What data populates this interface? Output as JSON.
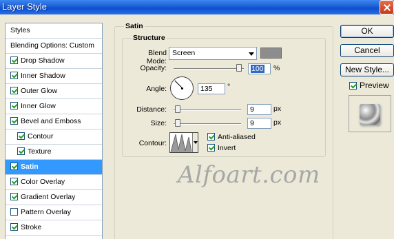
{
  "window": {
    "title": "Layer Style"
  },
  "styles_list": {
    "header": "Styles",
    "blending_options": "Blending Options: Custom",
    "items": [
      {
        "label": "Drop Shadow",
        "checked": true
      },
      {
        "label": "Inner Shadow",
        "checked": true
      },
      {
        "label": "Outer Glow",
        "checked": true
      },
      {
        "label": "Inner Glow",
        "checked": true
      },
      {
        "label": "Bevel and Emboss",
        "checked": true
      },
      {
        "label": "Contour",
        "checked": true
      },
      {
        "label": "Texture",
        "checked": true
      },
      {
        "label": "Satin",
        "checked": true,
        "selected": true
      },
      {
        "label": "Color Overlay",
        "checked": true
      },
      {
        "label": "Gradient Overlay",
        "checked": true
      },
      {
        "label": "Pattern Overlay",
        "checked": false
      },
      {
        "label": "Stroke",
        "checked": true
      }
    ]
  },
  "satin": {
    "group_title": "Satin",
    "structure_title": "Structure",
    "blend_mode_label": "Blend Mode:",
    "blend_mode_value": "Screen",
    "blend_color": "#8d8d8d",
    "opacity_label": "Opacity:",
    "opacity_value": "100",
    "opacity_unit": "%",
    "opacity_level": 1.0,
    "angle_label": "Angle:",
    "angle_value": "135",
    "angle_unit": "°",
    "distance_label": "Distance:",
    "distance_value": "9",
    "distance_unit": "px",
    "size_label": "Size:",
    "size_value": "9",
    "size_unit": "px",
    "contour_label": "Contour:",
    "anti_aliased_label": "Anti-aliased",
    "anti_aliased_checked": true,
    "invert_label": "Invert",
    "invert_checked": true
  },
  "watermark": "Alfoart.com",
  "buttons": {
    "ok": "OK",
    "cancel": "Cancel",
    "new_style": "New Style...",
    "preview_label": "Preview",
    "preview_checked": true
  },
  "colors": {
    "title_bar": "#0a4fd0",
    "selection": "#3399ff",
    "dialog_bg": "#ece9d8"
  },
  "icons": [
    "close-icon",
    "dropdown-arrow-icon",
    "checkbox-checked-icon",
    "angle-dial-icon",
    "contour-curve-icon"
  ]
}
